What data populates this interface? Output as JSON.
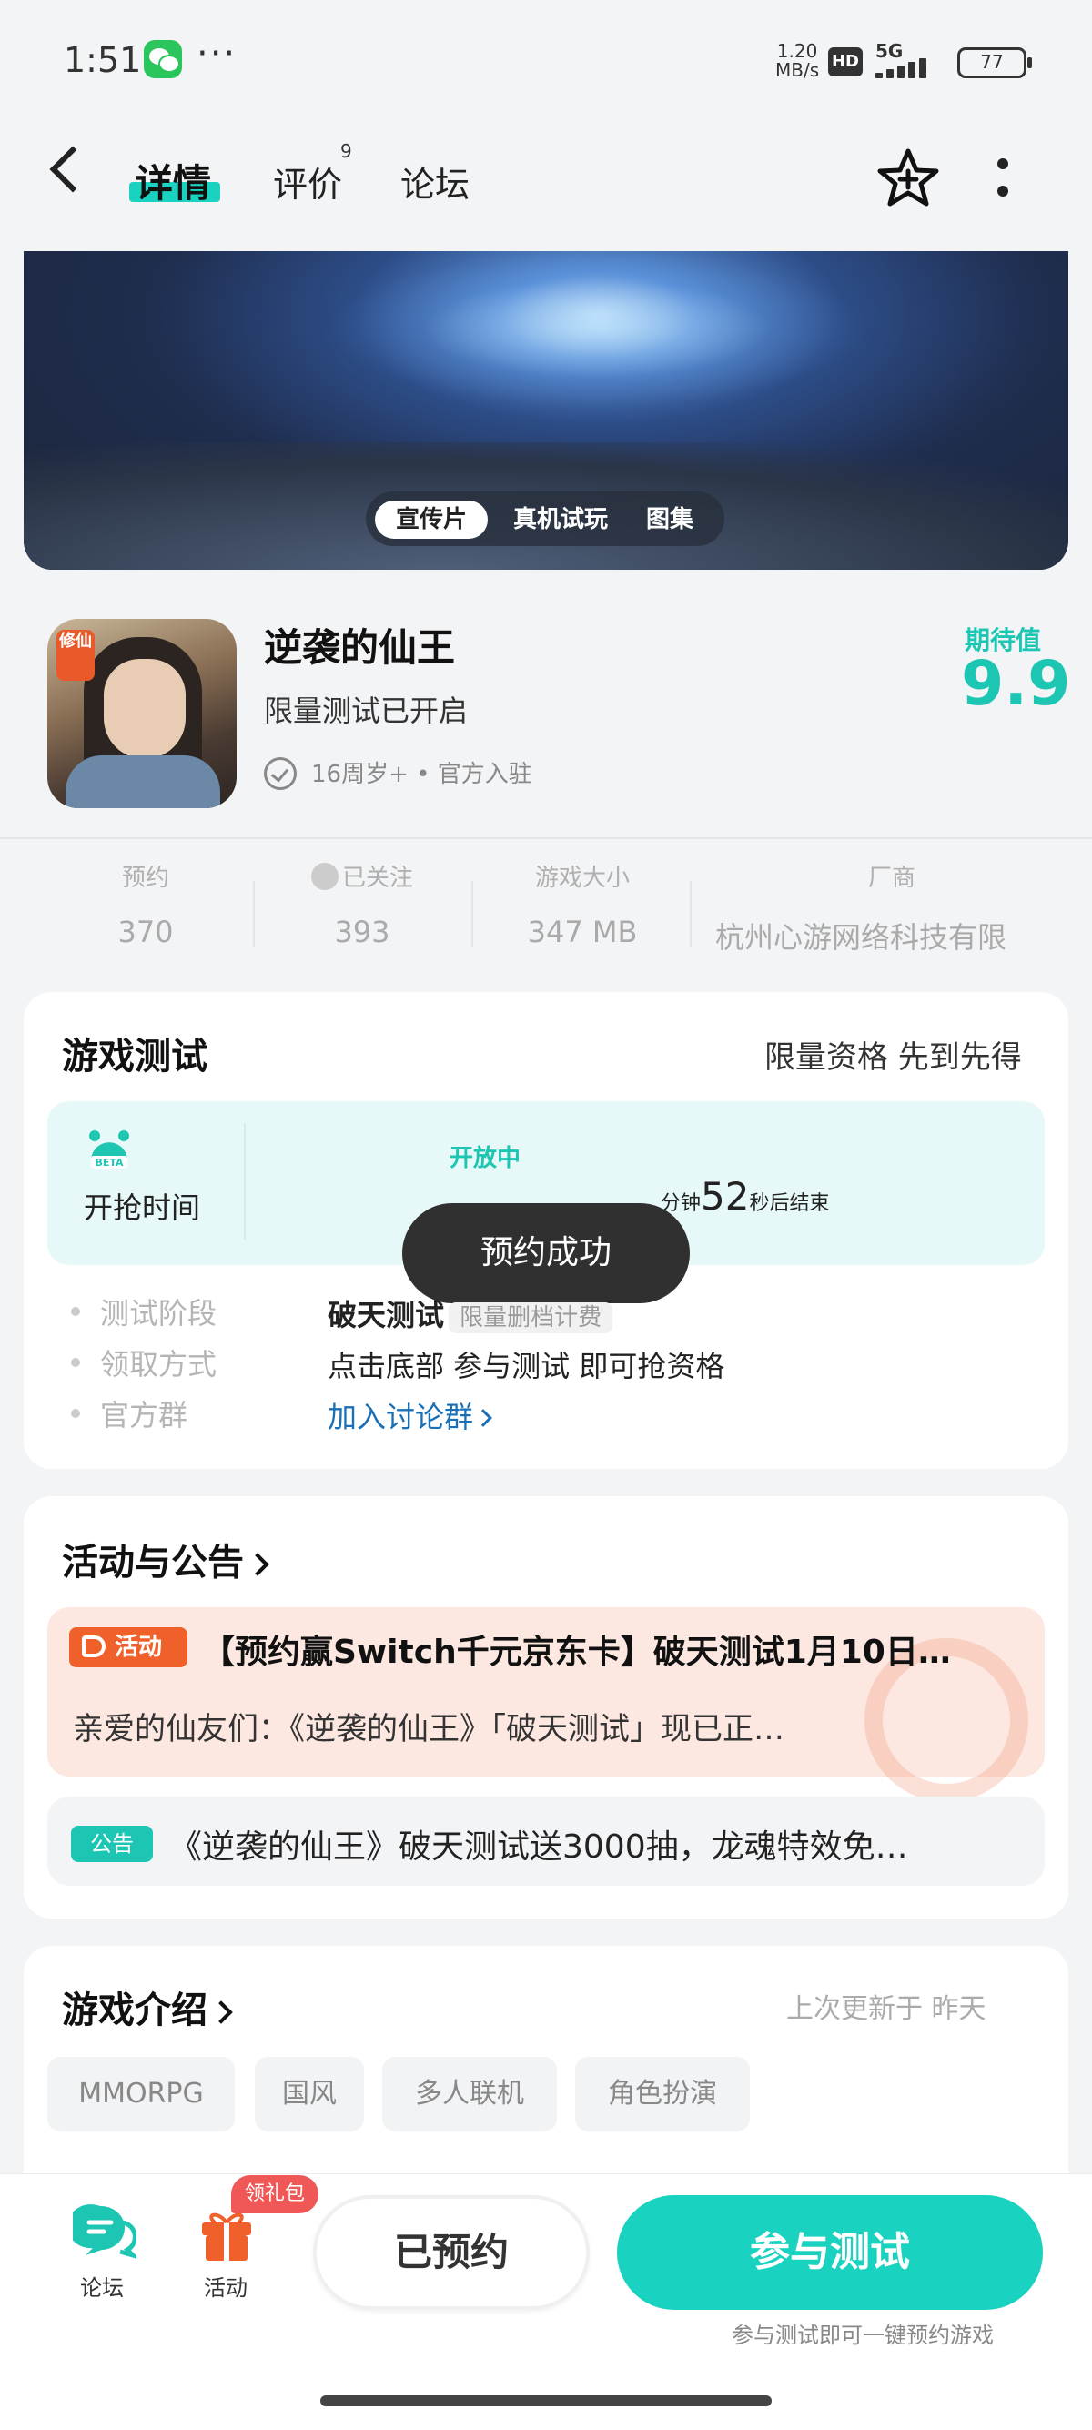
{
  "status_bar": {
    "time": "1:51",
    "speed_value": "1.20",
    "speed_unit": "MB/s",
    "hd": "HD",
    "network": "5G",
    "battery": "77"
  },
  "nav": {
    "tabs": [
      {
        "label": "详情"
      },
      {
        "label": "评价"
      },
      {
        "label": "论坛"
      }
    ],
    "review_count": "9"
  },
  "media": {
    "tabs": [
      "宣传片",
      "真机试玩",
      "图集"
    ]
  },
  "game": {
    "icon_tag": "修仙",
    "title": "逆袭的仙王",
    "subtitle": "限量测试已开启",
    "meta": "16周岁+ • 官方入驻",
    "expect_label": "期待值",
    "expect_score": "9.9"
  },
  "stats": [
    {
      "label": "预约",
      "value": "370"
    },
    {
      "label": "已关注",
      "value": "393"
    },
    {
      "label": "游戏大小",
      "value": "347 MB"
    },
    {
      "label": "厂商",
      "value": "杭州心游网络科技有限"
    }
  ],
  "test": {
    "title": "游戏测试",
    "right_note": "限量资格 先到先得",
    "panel_label": "开抢时间",
    "status": "开放中",
    "countdown_sec": "52",
    "countdown_min_unit": "分钟",
    "countdown_sec_unit": "秒后结束",
    "info": [
      {
        "key": "测试阶段",
        "value": "破天测试",
        "badge": "限量删档计费"
      },
      {
        "key": "领取方式",
        "value": "点击底部 参与测试 即可抢资格"
      },
      {
        "key": "官方群",
        "value": "加入讨论群"
      }
    ]
  },
  "toast": "预约成功",
  "activity": {
    "title": "活动与公告",
    "activity_badge": "活动",
    "activity_title": "【预约赢Switch千元京东卡】破天测试1月10日…",
    "activity_desc": "亲爱的仙友们：《逆袭的仙王》「破天测试」现已正…",
    "notice_badge": "公告",
    "notice_title": "《逆袭的仙王》破天测试送3000抽，龙魂特效免…"
  },
  "intro": {
    "title": "游戏介绍",
    "update_time": "上次更新于 昨天",
    "tags": [
      "MMORPG",
      "国风",
      "多人联机",
      "角色扮演"
    ]
  },
  "bottom": {
    "forum": "论坛",
    "activity": "活动",
    "gift_badge": "领礼包",
    "reserved": "已预约",
    "join": "参与测试",
    "join_hint": "参与测试即可一键预约游戏"
  },
  "colors": {
    "accent": "#19d2c0",
    "activity": "#f0602a",
    "toast_bg": "#303030"
  }
}
